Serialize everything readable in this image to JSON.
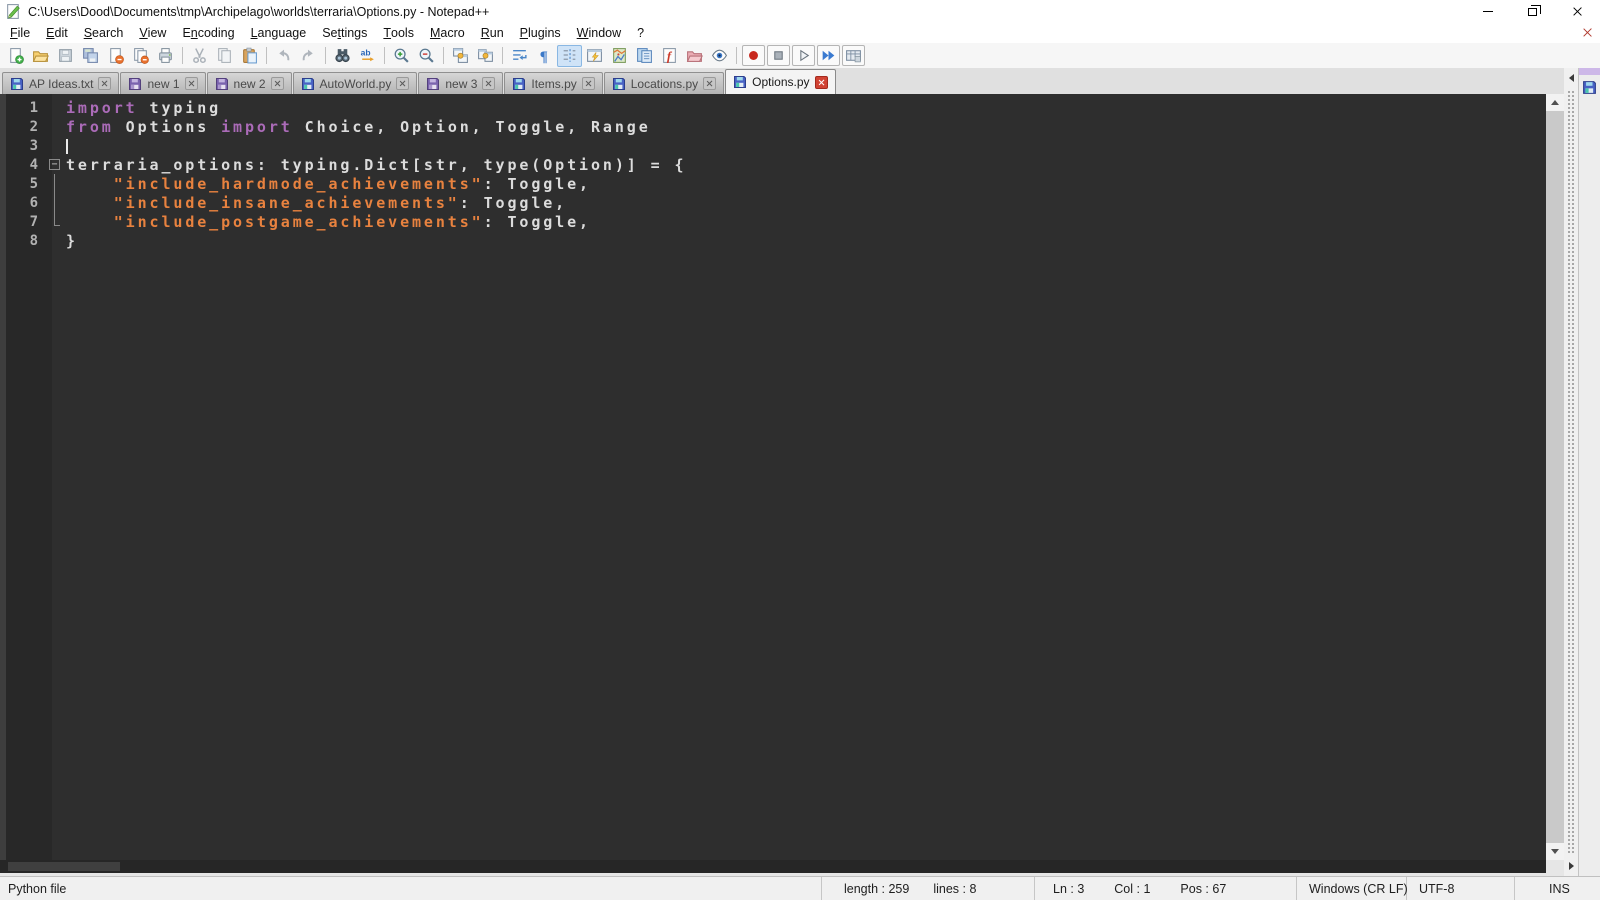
{
  "window": {
    "title": "C:\\Users\\Dood\\Documents\\tmp\\Archipelago\\worlds\\terraria\\Options.py - Notepad++",
    "controls": [
      "minimize",
      "restore-down",
      "close"
    ]
  },
  "menu": {
    "items": [
      {
        "label": "File",
        "u": 0
      },
      {
        "label": "Edit",
        "u": 0
      },
      {
        "label": "Search",
        "u": 0
      },
      {
        "label": "View",
        "u": 0
      },
      {
        "label": "Encoding",
        "u": 1
      },
      {
        "label": "Language",
        "u": 0
      },
      {
        "label": "Settings",
        "u": 2
      },
      {
        "label": "Tools",
        "u": 0
      },
      {
        "label": "Macro",
        "u": 0
      },
      {
        "label": "Run",
        "u": 0
      },
      {
        "label": "Plugins",
        "u": 0
      },
      {
        "label": "Window",
        "u": 0
      },
      {
        "label": "?",
        "u": -1
      }
    ]
  },
  "toolbar": {
    "icons": [
      {
        "name": "new-file"
      },
      {
        "name": "open-file"
      },
      {
        "name": "save",
        "disabled": true
      },
      {
        "name": "save-all"
      },
      {
        "name": "close-document"
      },
      {
        "name": "close-all-documents"
      },
      {
        "name": "print"
      },
      {
        "name": "separator"
      },
      {
        "name": "cut",
        "disabled": true
      },
      {
        "name": "copy",
        "disabled": true
      },
      {
        "name": "paste"
      },
      {
        "name": "separator"
      },
      {
        "name": "undo",
        "disabled": true
      },
      {
        "name": "redo",
        "disabled": true
      },
      {
        "name": "separator"
      },
      {
        "name": "find"
      },
      {
        "name": "replace"
      },
      {
        "name": "separator"
      },
      {
        "name": "zoom-in"
      },
      {
        "name": "zoom-out"
      },
      {
        "name": "separator"
      },
      {
        "name": "sync-vertical-scroll"
      },
      {
        "name": "sync-horizontal-scroll"
      },
      {
        "name": "separator"
      },
      {
        "name": "word-wrap"
      },
      {
        "name": "show-all-characters"
      },
      {
        "name": "indent-guide",
        "active": true
      },
      {
        "name": "function-panel"
      },
      {
        "name": "document-map"
      },
      {
        "name": "document-list"
      },
      {
        "name": "function-list"
      },
      {
        "name": "folder-as-workspace"
      },
      {
        "name": "monitoring"
      },
      {
        "name": "separator"
      },
      {
        "name": "macro-record",
        "boxed": true
      },
      {
        "name": "macro-stop",
        "boxed": true
      },
      {
        "name": "macro-play",
        "boxed": true
      },
      {
        "name": "macro-run-multiple",
        "boxed": true
      },
      {
        "name": "macro-save",
        "boxed": true
      }
    ]
  },
  "tabs": [
    {
      "label": "AP Ideas.txt",
      "icon": "floppy-saved",
      "active": false
    },
    {
      "label": "new 1",
      "icon": "floppy-new",
      "active": false
    },
    {
      "label": "new 2",
      "icon": "floppy-new",
      "active": false
    },
    {
      "label": "AutoWorld.py",
      "icon": "floppy-saved",
      "active": false
    },
    {
      "label": "new 3",
      "icon": "floppy-new",
      "active": false
    },
    {
      "label": "Items.py",
      "icon": "floppy-saved",
      "active": false
    },
    {
      "label": "Locations.py",
      "icon": "floppy-saved",
      "active": false
    },
    {
      "label": "Options.py",
      "icon": "floppy-saved",
      "active": true
    }
  ],
  "editor": {
    "fold_marker": "−",
    "lines": [
      {
        "n": "1",
        "segs": [
          [
            "kw",
            "import"
          ],
          [
            "def",
            " typing"
          ]
        ]
      },
      {
        "n": "2",
        "segs": [
          [
            "kw",
            "from"
          ],
          [
            "def",
            " Options "
          ],
          [
            "kw",
            "import"
          ],
          [
            "def",
            " Choice, Option, Toggle, Range"
          ]
        ]
      },
      {
        "n": "3",
        "segs": [],
        "caret": true
      },
      {
        "n": "4",
        "segs": [
          [
            "def",
            "terraria_options: typing.Dict[str, type(Option)] = {"
          ]
        ],
        "fold": "start"
      },
      {
        "n": "5",
        "segs": [
          [
            "def",
            "    "
          ],
          [
            "str",
            "\"include_hardmode_achievements\""
          ],
          [
            "def",
            ": Toggle,"
          ]
        ],
        "fold": "mid"
      },
      {
        "n": "6",
        "segs": [
          [
            "def",
            "    "
          ],
          [
            "str",
            "\"include_insane_achievements\""
          ],
          [
            "def",
            ": Toggle,"
          ]
        ],
        "fold": "mid"
      },
      {
        "n": "7",
        "segs": [
          [
            "def",
            "    "
          ],
          [
            "str",
            "\"include_postgame_achievements\""
          ],
          [
            "def",
            ": Toggle,"
          ]
        ],
        "fold": "end"
      },
      {
        "n": "8",
        "segs": [
          [
            "def",
            "}"
          ]
        ]
      }
    ]
  },
  "status": {
    "doc_type": "Python file",
    "length": "length : 259",
    "lines": "lines : 8",
    "ln": "Ln : 3",
    "col": "Col : 1",
    "pos": "Pos : 67",
    "eol": "Windows (CR LF)",
    "encoding": "UTF-8",
    "insert_mode": "INS"
  },
  "colors": {
    "keyword": "#ab6bb8",
    "string": "#e8823f",
    "default_text": "#dcdcdc",
    "editor_bg": "#2e2e2e",
    "active_tab_close": "#d14334"
  }
}
